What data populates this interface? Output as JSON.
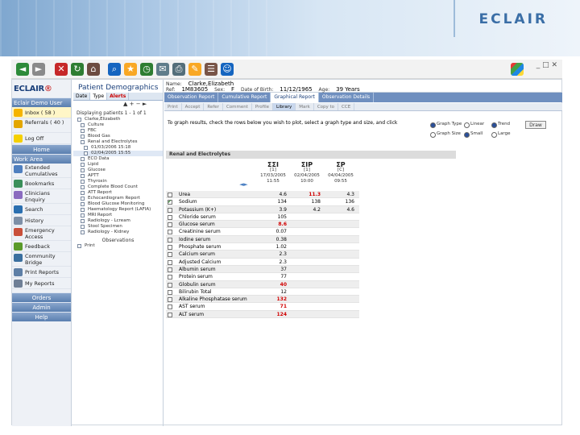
{
  "banner": {
    "logo": "ECLAIR"
  },
  "toolbar": {
    "icons": [
      "back-icon",
      "forward-icon",
      "stop-icon",
      "refresh-icon",
      "home-icon",
      "search-icon",
      "favorites-icon",
      "history-icon",
      "mail-icon",
      "print-icon",
      "edit-icon",
      "discuss-icon",
      "messenger-icon"
    ]
  },
  "sidebar": {
    "brand_a": "ECLAIR",
    "brand_b": "®",
    "user": "Eclair Demo User",
    "items_top": [
      {
        "label": "Inbox ( 58 )"
      },
      {
        "label": "Referrals ( 40 )"
      },
      {
        "label": "Log Off"
      }
    ],
    "home": "Home",
    "work_area": "Work Area",
    "items_work": [
      {
        "label": "Extended Cumulatives"
      },
      {
        "label": "Bookmarks"
      },
      {
        "label": "Clinicians Enquiry"
      },
      {
        "label": "Search"
      },
      {
        "label": "History"
      },
      {
        "label": "Emergency Access"
      },
      {
        "label": "Feedback"
      },
      {
        "label": "Community Bridge"
      },
      {
        "label": "Print Reports"
      },
      {
        "label": "My Reports"
      }
    ],
    "orders": "Orders",
    "admin": "Admin",
    "help": "Help"
  },
  "mid": {
    "title": "Patient Demographics",
    "tabs": [
      "Date",
      "Type",
      "Alerts"
    ],
    "displaying": "Displaying patients 1 - 1 of 1",
    "patient": "Clarke,Elizabeth",
    "tree": [
      "Culture",
      "FBC",
      "Blood Gas",
      "Renal and Electrolytes",
      "01/03/2006 15:18",
      "02/04/2005 15:55",
      "ECO Data",
      "Lipid",
      "Glucose",
      "APTT",
      "Thyroxin",
      "Complete Blood Count",
      "ATT Report",
      "Echocardiogram Report",
      "Blood Glucose Monitoring",
      "Haematology Report (LAFIA)",
      "MRI Report",
      "Radiology - Lcream",
      "Stool Specimen",
      "Radiology - Kidney"
    ],
    "observations": "Observations",
    "print": "Print"
  },
  "patient": {
    "name_label": "Name:",
    "name": "Clarke,Elizabeth",
    "ref_label": "Ref:",
    "ref": "1M83605",
    "sex_label": "Sex:",
    "sex": "F",
    "dob_label": "Date of Birth:",
    "dob": "11/12/1965",
    "age_label": "Age:",
    "age": "39 Years"
  },
  "report_tabs": [
    "Observation Report",
    "Cumulative Report",
    "Graphical Report",
    "Observation Details"
  ],
  "sub_tabs": [
    "Print",
    "Accept",
    "Refer",
    "Comment",
    "Profile",
    "Library",
    "Mark",
    "Copy to",
    "CCE"
  ],
  "instruction": "To graph results, check the rows below you wish to plot, select a graph type and size, and click",
  "graph_options": {
    "type_label": "Graph Type",
    "types": [
      "Linear",
      "Trend"
    ],
    "size_label": "Graph Size",
    "sizes": [
      "Small",
      "Large"
    ],
    "button": "Draw"
  },
  "section": "Renal and Electrolytes",
  "columns": [
    {
      "mark": "ΣΣΙ",
      "code": "[1]",
      "date": "17/03/2005",
      "time": "11:55"
    },
    {
      "mark": "ΣΙΡ",
      "code": "[1]",
      "date": "02/04/2005",
      "time": "10:00"
    },
    {
      "mark": "ΣΡ",
      "code": "[C]",
      "date": "04/04/2005",
      "time": "09:55"
    }
  ],
  "rows": [
    {
      "name": "Urea",
      "v": [
        "4.6",
        "11.3",
        "4.3"
      ],
      "red": [
        false,
        true,
        false
      ],
      "checked": false
    },
    {
      "name": "Sodium",
      "v": [
        "134",
        "138",
        "136"
      ],
      "red": [
        false,
        false,
        false
      ],
      "checked": true
    },
    {
      "name": "Potassium (K+)",
      "v": [
        "3.9",
        "4.2",
        "4.6"
      ],
      "red": [
        false,
        false,
        false
      ],
      "checked": false
    },
    {
      "name": "Chloride serum",
      "v": [
        "105",
        "",
        ""
      ],
      "red": [
        false,
        false,
        false
      ],
      "checked": false
    },
    {
      "name": "Glucose serum",
      "v": [
        "8.6",
        "",
        ""
      ],
      "red": [
        true,
        false,
        false
      ],
      "checked": false
    },
    {
      "name": "Creatinine serum",
      "v": [
        "0.07",
        "",
        ""
      ],
      "red": [
        false,
        false,
        false
      ],
      "checked": false
    },
    {
      "name": "Iodine serum",
      "v": [
        "0.38",
        "",
        ""
      ],
      "red": [
        false,
        false,
        false
      ],
      "checked": false
    },
    {
      "name": "Phosphate serum",
      "v": [
        "1.02",
        "",
        ""
      ],
      "red": [
        false,
        false,
        false
      ],
      "checked": false
    },
    {
      "name": "Calcium serum",
      "v": [
        "2.3",
        "",
        ""
      ],
      "red": [
        false,
        false,
        false
      ],
      "checked": false
    },
    {
      "name": "Adjusted Calcium",
      "v": [
        "2.3",
        "",
        ""
      ],
      "red": [
        false,
        false,
        false
      ],
      "checked": false
    },
    {
      "name": "Albumin serum",
      "v": [
        "37",
        "",
        ""
      ],
      "red": [
        false,
        false,
        false
      ],
      "checked": false
    },
    {
      "name": "Protein serum",
      "v": [
        "77",
        "",
        ""
      ],
      "red": [
        false,
        false,
        false
      ],
      "checked": false
    },
    {
      "name": "Globulin serum",
      "v": [
        "40",
        "",
        ""
      ],
      "red": [
        true,
        false,
        false
      ],
      "checked": false
    },
    {
      "name": "Bilirubin Total",
      "v": [
        "12",
        "",
        ""
      ],
      "red": [
        false,
        false,
        false
      ],
      "checked": false
    },
    {
      "name": "Alkaline Phosphatase serum",
      "v": [
        "132",
        "",
        ""
      ],
      "red": [
        true,
        false,
        false
      ],
      "checked": false
    },
    {
      "name": "AST serum",
      "v": [
        "71",
        "",
        ""
      ],
      "red": [
        true,
        false,
        false
      ],
      "checked": false
    },
    {
      "name": "ALT serum",
      "v": [
        "124",
        "",
        ""
      ],
      "red": [
        true,
        false,
        false
      ],
      "checked": false
    }
  ]
}
